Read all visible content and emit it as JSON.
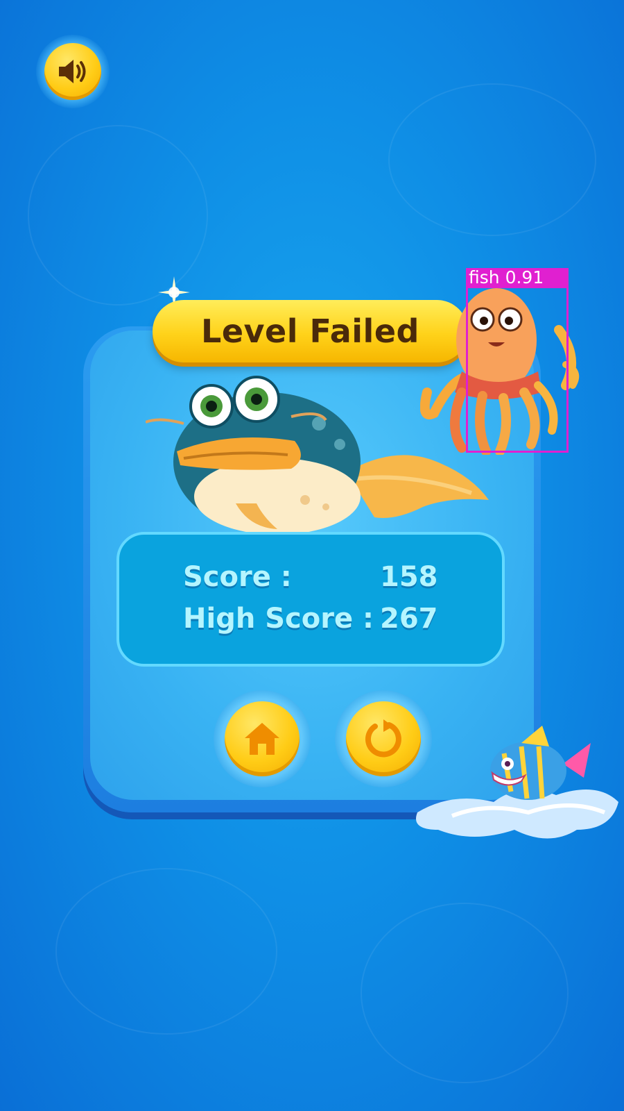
{
  "hud": {
    "sound_icon": "speaker-icon"
  },
  "dialog": {
    "title": "Level Failed",
    "score_label": "Score :",
    "score_value": "158",
    "high_score_label": "High Score :",
    "high_score_value": "267",
    "home_icon": "home-icon",
    "retry_icon": "retry-icon"
  },
  "detection": {
    "label": "fish  0.91"
  },
  "colors": {
    "accent_yellow": "#ffcc16",
    "title_text": "#4a2a0a",
    "score_text": "#b5f5ff",
    "detection_box": "#e020d0"
  }
}
